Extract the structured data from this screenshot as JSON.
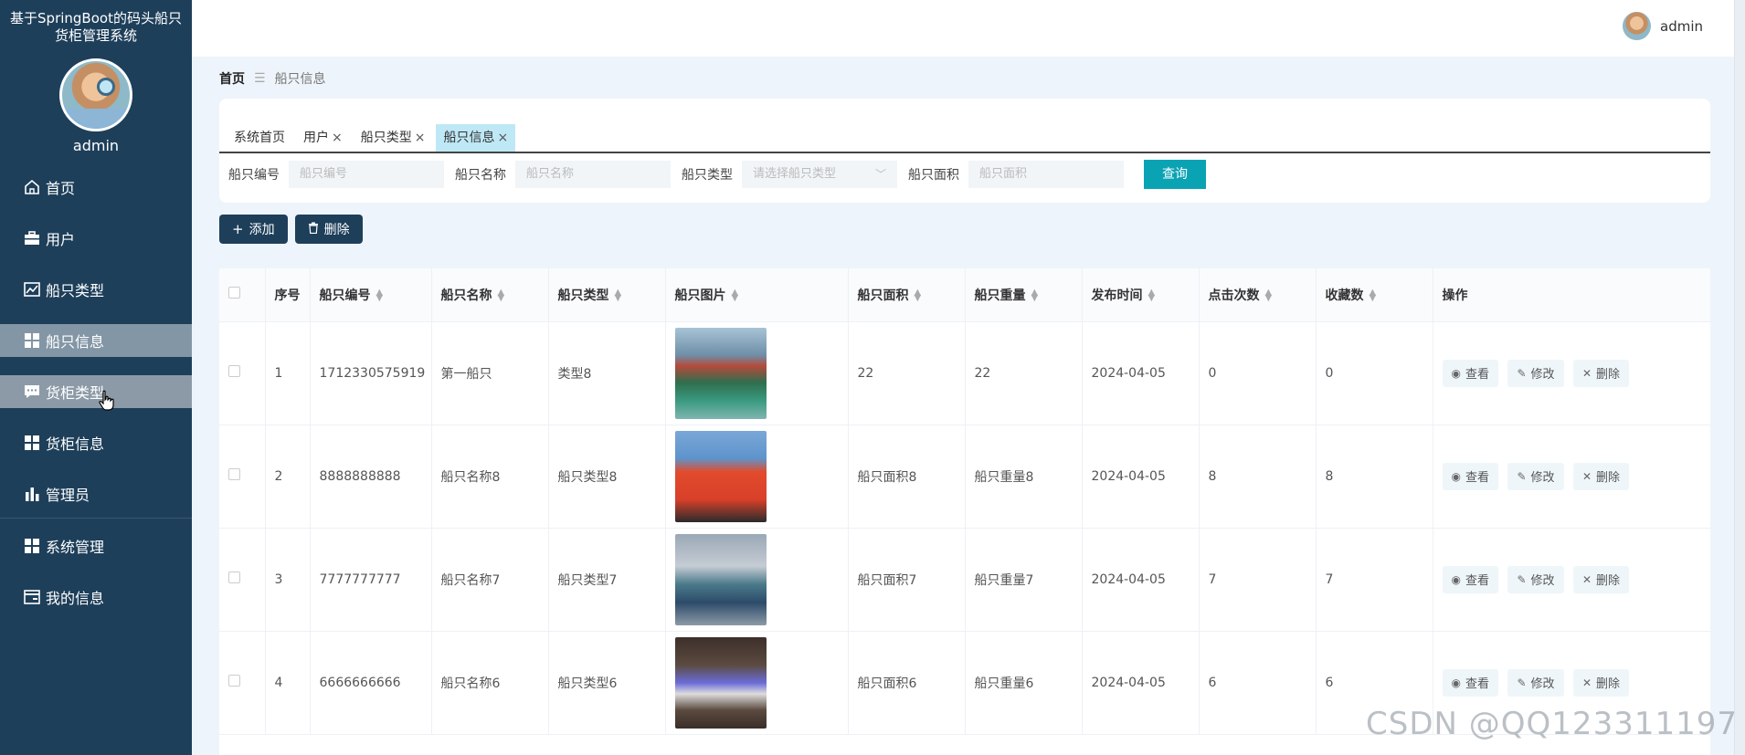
{
  "sidebar": {
    "system_title_line1": "基于SpringBoot的码头船只",
    "system_title_line2": "货柜管理系统",
    "admin_name": "admin",
    "items": [
      {
        "label": "首页",
        "icon": "home-icon"
      },
      {
        "label": "用户",
        "icon": "briefcase-icon"
      },
      {
        "label": "船只类型",
        "icon": "chart-line-icon"
      },
      {
        "label": "船只信息",
        "icon": "grid-icon"
      },
      {
        "label": "货柜类型",
        "icon": "chat-icon"
      },
      {
        "label": "货柜信息",
        "icon": "grid-icon"
      },
      {
        "label": "管理员",
        "icon": "bar-chart-icon"
      },
      {
        "label": "系统管理",
        "icon": "grid-icon"
      },
      {
        "label": "我的信息",
        "icon": "id-card-icon"
      }
    ]
  },
  "topbar": {
    "user": "admin"
  },
  "breadcrumb": {
    "home": "首页",
    "separator": "☰",
    "current": "船只信息"
  },
  "tabs": [
    {
      "label": "系统首页",
      "closable": false
    },
    {
      "label": "用户",
      "closable": true
    },
    {
      "label": "船只类型",
      "closable": true
    },
    {
      "label": "船只信息",
      "closable": true
    }
  ],
  "search": {
    "code_label": "船只编号",
    "code_placeholder": "船只编号",
    "name_label": "船只名称",
    "name_placeholder": "船只名称",
    "type_label": "船只类型",
    "type_placeholder": "请选择船只类型",
    "area_label": "船只面积",
    "area_placeholder": "船只面积",
    "query_button": "查询"
  },
  "actions": {
    "add": "添加",
    "delete": "删除"
  },
  "table": {
    "headers": [
      "序号",
      "船只编号",
      "船只名称",
      "船只类型",
      "船只图片",
      "船只面积",
      "船只重量",
      "发布时间",
      "点击次数",
      "收藏数",
      "操作"
    ],
    "rows": [
      {
        "idx": "1",
        "code": "1712330575919",
        "name": "第一船只",
        "type": "类型8",
        "area": "22",
        "weight": "22",
        "date": "2024-04-05",
        "clicks": "0",
        "favs": "0"
      },
      {
        "idx": "2",
        "code": "8888888888",
        "name": "船只名称8",
        "type": "船只类型8",
        "area": "船只面积8",
        "weight": "船只重量8",
        "date": "2024-04-05",
        "clicks": "8",
        "favs": "8"
      },
      {
        "idx": "3",
        "code": "7777777777",
        "name": "船只名称7",
        "type": "船只类型7",
        "area": "船只面积7",
        "weight": "船只重量7",
        "date": "2024-04-05",
        "clicks": "7",
        "favs": "7"
      },
      {
        "idx": "4",
        "code": "6666666666",
        "name": "船只名称6",
        "type": "船只类型6",
        "area": "船只面积6",
        "weight": "船只重量6",
        "date": "2024-04-05",
        "clicks": "6",
        "favs": "6"
      }
    ],
    "op_view": "查看",
    "op_edit": "修改",
    "op_delete": "删除"
  },
  "watermark": "CSDN @QQ123311197"
}
